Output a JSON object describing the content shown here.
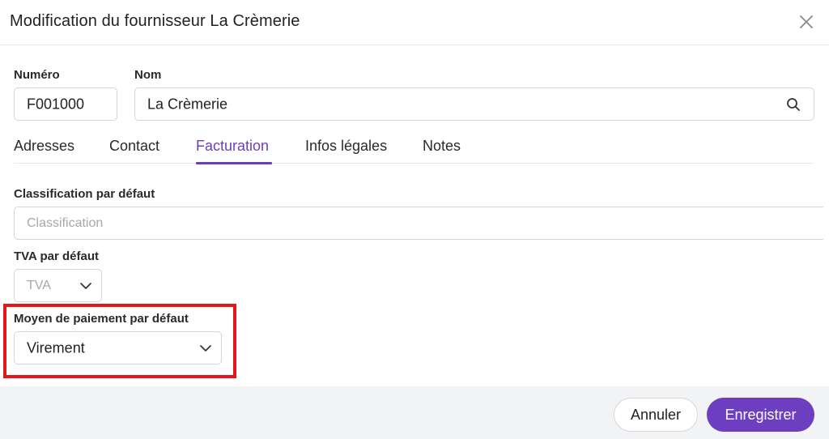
{
  "dialog": {
    "title": "Modification du fournisseur La Crèmerie"
  },
  "fields": {
    "numero": {
      "label": "Numéro",
      "value": "F001000"
    },
    "nom": {
      "label": "Nom",
      "value": "La Crèmerie"
    },
    "classification": {
      "label": "Classification par défaut",
      "placeholder": "Classification"
    },
    "tva": {
      "label": "TVA par défaut",
      "placeholder": "TVA"
    },
    "paiement": {
      "label": "Moyen de paiement par défaut",
      "value": "Virement"
    }
  },
  "tabs": [
    {
      "label": "Adresses",
      "active": false
    },
    {
      "label": "Contact",
      "active": false
    },
    {
      "label": "Facturation",
      "active": true
    },
    {
      "label": "Infos légales",
      "active": false
    },
    {
      "label": "Notes",
      "active": false
    }
  ],
  "footer": {
    "cancel_label": "Annuler",
    "save_label": "Enregistrer"
  },
  "colors": {
    "accent": "#6d3fc0",
    "highlight": "#e3161c",
    "footer_bg": "#f2f3f5"
  },
  "icons": [
    "close-icon",
    "search-icon",
    "chevron-down-icon"
  ]
}
